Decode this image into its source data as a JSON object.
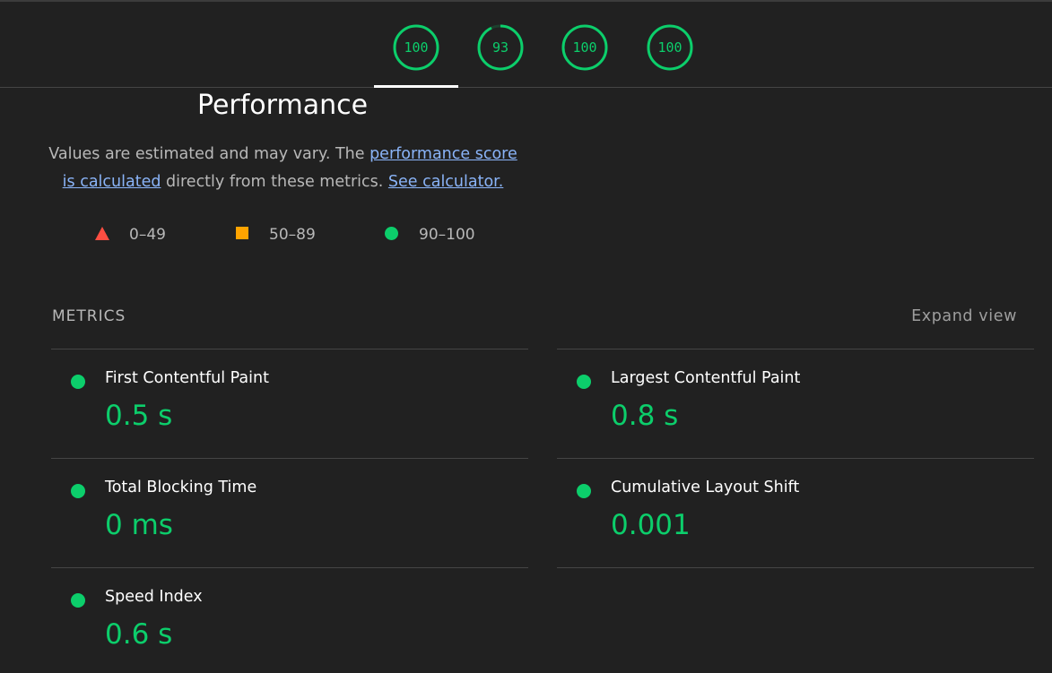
{
  "gauges": [
    {
      "value": "100",
      "score": 1.0,
      "color": "#0cce6b"
    },
    {
      "value": "93",
      "score": 0.93,
      "color": "#0cce6b"
    },
    {
      "value": "100",
      "score": 1.0,
      "color": "#0cce6b"
    },
    {
      "value": "100",
      "score": 1.0,
      "color": "#0cce6b"
    }
  ],
  "performance": {
    "title": "Performance",
    "desc_prefix": "Values are estimated and may vary. The ",
    "score_link": "performance score is calculated",
    "desc_middle": " directly from these metrics. ",
    "calculator_link": "See calculator."
  },
  "legend": [
    {
      "icon": "triangle-icon",
      "label": "0–49",
      "color": "#ff4e42"
    },
    {
      "icon": "square-icon",
      "label": "50–89",
      "color": "#ffa400"
    },
    {
      "icon": "circle-icon",
      "label": "90–100",
      "color": "#0cce6b"
    }
  ],
  "metrics": {
    "heading": "METRICS",
    "expand_label": "Expand view",
    "items": [
      {
        "name": "First Contentful Paint",
        "value": "0.5 s"
      },
      {
        "name": "Largest Contentful Paint",
        "value": "0.8 s"
      },
      {
        "name": "Total Blocking Time",
        "value": "0 ms"
      },
      {
        "name": "Cumulative Layout Shift",
        "value": "0.001"
      },
      {
        "name": "Speed Index",
        "value": "0.6 s"
      }
    ]
  },
  "colors": {
    "background": "#212121",
    "pass": "#0cce6b",
    "average": "#ffa400",
    "fail": "#ff4e42",
    "link": "#8ab4f8"
  }
}
